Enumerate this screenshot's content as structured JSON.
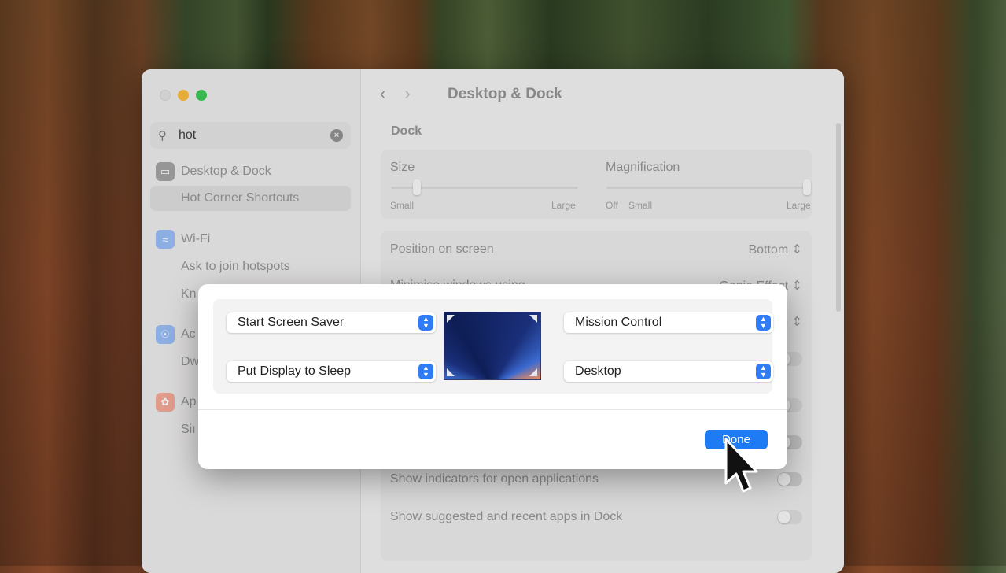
{
  "window": {
    "search": {
      "value": "hot"
    },
    "sidebar": {
      "items": [
        {
          "label": "Desktop & Dock",
          "icon": "desktop-dock-icon",
          "color": "#7a7a7a"
        },
        {
          "label": "Hot Corner Shortcuts",
          "sub": true,
          "selected": true
        },
        {
          "label": "Wi-Fi",
          "icon": "wifi-icon",
          "color": "#2f7cf6"
        },
        {
          "label": "Ask to join hotspots",
          "sub": true
        },
        {
          "label": "Kn",
          "sub": true
        },
        {
          "label": "Ac",
          "icon": "accessibility-icon",
          "color": "#2f7cf6"
        },
        {
          "label": "Dw",
          "sub": true
        },
        {
          "label": "Ap",
          "icon": "apple-intelligence-icon",
          "color": "#e8563a"
        },
        {
          "label": "Siı",
          "sub": true
        }
      ]
    },
    "header": {
      "title": "Desktop & Dock"
    },
    "dock": {
      "section": "Dock",
      "size_label": "Size",
      "size_min": "Small",
      "size_max": "Large",
      "size_level": 0.14,
      "mag_label": "Magnification",
      "mag_off": "Off",
      "mag_small": "Small",
      "mag_max": "Large",
      "mag_level": 1.0,
      "position_label": "Position on screen",
      "position_value": "Bottom",
      "minimize_label": "Minimise windows using",
      "minimize_value": "Genie Effect",
      "row3_value": "n",
      "indicators_label": "Show indicators for open applications",
      "suggested_label": "Show suggested and recent apps in Dock"
    }
  },
  "modal": {
    "top_left": "Start Screen Saver",
    "top_right": "Mission Control",
    "bottom_left": "Put Display to Sleep",
    "bottom_right": "Desktop",
    "done": "Done",
    "accent": "#1f7bf3"
  }
}
